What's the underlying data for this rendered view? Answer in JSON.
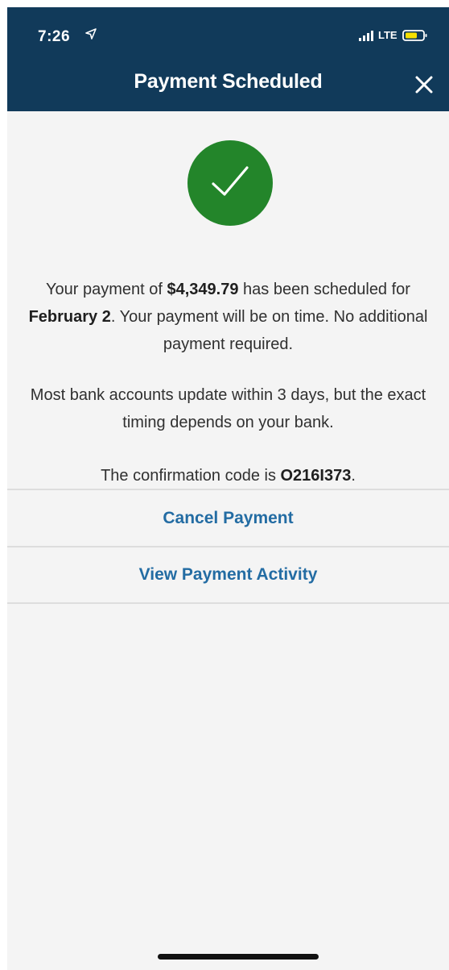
{
  "status_bar": {
    "time": "7:26",
    "network": "LTE",
    "icons": {
      "location": "location-arrow-icon",
      "signal": "signal-bars-icon",
      "battery": "battery-icon"
    }
  },
  "header": {
    "title": "Payment Scheduled",
    "close_icon": "close-icon"
  },
  "success": {
    "icon": "checkmark-icon",
    "color": "#23852a"
  },
  "messages": {
    "payment_prefix": "Your payment of ",
    "amount": "$4,349.79",
    "payment_middle": " has been scheduled for ",
    "date": "February 2",
    "payment_suffix": ". Your payment will be on time. No additional payment required.",
    "bank_notice": "Most bank accounts update within 3 days, but the exact timing depends on your bank.",
    "confirmation_prefix": "The confirmation code is ",
    "confirmation_code": "O216I373",
    "confirmation_suffix": "."
  },
  "actions": {
    "cancel_payment": "Cancel Payment",
    "view_payment_activity": "View Payment Activity"
  },
  "colors": {
    "header_background": "#113a5a",
    "success_green": "#23852a",
    "link_blue": "#236ca3",
    "page_background": "#f4f4f4"
  }
}
